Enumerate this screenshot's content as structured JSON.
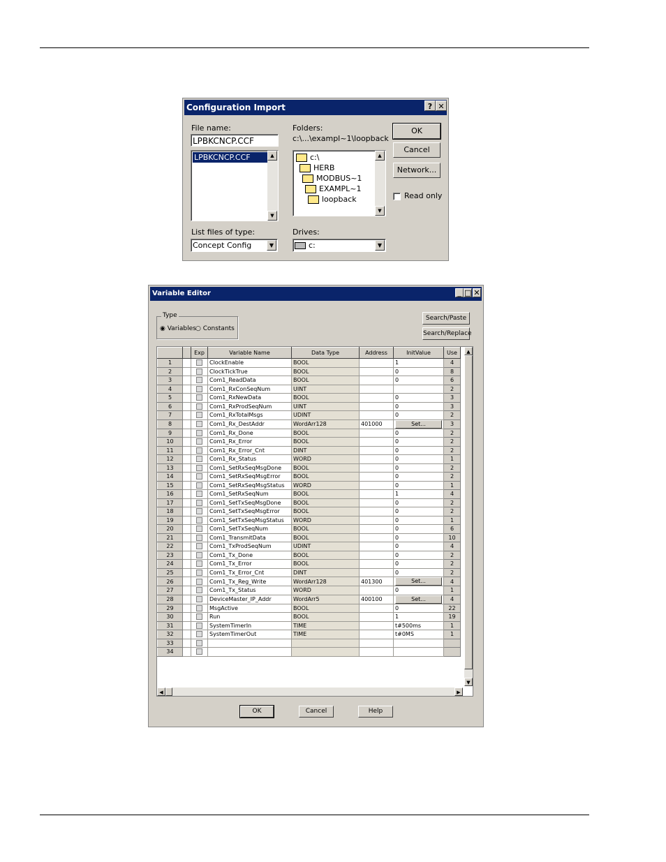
{
  "config_import": {
    "title": "Configuration Import",
    "help_btn": "?",
    "close_btn": "✕",
    "file_name_label": "File name:",
    "file_name_value": "LPBKCNCP.CCF",
    "file_list": [
      "LPBKCNCP.CCF"
    ],
    "folders_label": "Folders:",
    "folders_path": "c:\\...\\exampl~1\\loopback",
    "folders": [
      "c:\\",
      "HERB",
      "MODBUS~1",
      "EXAMPL~1",
      "loopback"
    ],
    "ok": "OK",
    "cancel": "Cancel",
    "network": "Network...",
    "read_only": "Read only",
    "list_type_label": "List files of type:",
    "list_type_value": "Concept Config (*.ccf)",
    "drives_label": "Drives:",
    "drives_value": "c:"
  },
  "variable_editor": {
    "title": "Variable Editor",
    "type_group": "Type",
    "radio_variables": "Variables",
    "radio_constants": "Constants",
    "search_paste": "Search/Paste",
    "search_replace": "Search/Replace",
    "columns": [
      "",
      "",
      "Exp",
      "Variable Name",
      "Data Type",
      "Address",
      "InitValue",
      "Use"
    ],
    "rows": [
      {
        "n": "1",
        "name": "ClockEnable",
        "type": "BOOL",
        "addr": "",
        "init": "1",
        "use": "4"
      },
      {
        "n": "2",
        "name": "ClockTickTrue",
        "type": "BOOL",
        "addr": "",
        "init": "0",
        "use": "8"
      },
      {
        "n": "3",
        "name": "Com1_ReadData",
        "type": "BOOL",
        "addr": "",
        "init": "0",
        "use": "6"
      },
      {
        "n": "4",
        "name": "Com1_RxConSeqNum",
        "type": "UINT",
        "addr": "",
        "init": "",
        "use": "2"
      },
      {
        "n": "5",
        "name": "Com1_RxNewData",
        "type": "BOOL",
        "addr": "",
        "init": "0",
        "use": "3"
      },
      {
        "n": "6",
        "name": "Com1_RxProdSeqNum",
        "type": "UINT",
        "addr": "",
        "init": "0",
        "use": "3"
      },
      {
        "n": "7",
        "name": "Com1_RxTotalMsgs",
        "type": "UDINT",
        "addr": "",
        "init": "0",
        "use": "2"
      },
      {
        "n": "8",
        "name": "Com1_Rx_DestAddr",
        "type": "WordArr128",
        "addr": "401000",
        "init": "Set...",
        "use": "3"
      },
      {
        "n": "9",
        "name": "Com1_Rx_Done",
        "type": "BOOL",
        "addr": "",
        "init": "0",
        "use": "2"
      },
      {
        "n": "10",
        "name": "Com1_Rx_Error",
        "type": "BOOL",
        "addr": "",
        "init": "0",
        "use": "2"
      },
      {
        "n": "11",
        "name": "Com1_Rx_Error_Cnt",
        "type": "DINT",
        "addr": "",
        "init": "0",
        "use": "2"
      },
      {
        "n": "12",
        "name": "Com1_Rx_Status",
        "type": "WORD",
        "addr": "",
        "init": "0",
        "use": "1"
      },
      {
        "n": "13",
        "name": "Com1_SetRxSeqMsgDone",
        "type": "BOOL",
        "addr": "",
        "init": "0",
        "use": "2"
      },
      {
        "n": "14",
        "name": "Com1_SetRxSeqMsgError",
        "type": "BOOL",
        "addr": "",
        "init": "0",
        "use": "2"
      },
      {
        "n": "15",
        "name": "Com1_SetRxSeqMsgStatus",
        "type": "WORD",
        "addr": "",
        "init": "0",
        "use": "1"
      },
      {
        "n": "16",
        "name": "Com1_SetRxSeqNum",
        "type": "BOOL",
        "addr": "",
        "init": "1",
        "use": "4"
      },
      {
        "n": "17",
        "name": "Com1_SetTxSeqMsgDone",
        "type": "BOOL",
        "addr": "",
        "init": "0",
        "use": "2"
      },
      {
        "n": "18",
        "name": "Com1_SetTxSeqMsgError",
        "type": "BOOL",
        "addr": "",
        "init": "0",
        "use": "2"
      },
      {
        "n": "19",
        "name": "Com1_SetTxSeqMsgStatus",
        "type": "WORD",
        "addr": "",
        "init": "0",
        "use": "1"
      },
      {
        "n": "20",
        "name": "Com1_SetTxSeqNum",
        "type": "BOOL",
        "addr": "",
        "init": "0",
        "use": "6"
      },
      {
        "n": "21",
        "name": "Com1_TransmitData",
        "type": "BOOL",
        "addr": "",
        "init": "0",
        "use": "10"
      },
      {
        "n": "22",
        "name": "Com1_TxProdSeqNum",
        "type": "UDINT",
        "addr": "",
        "init": "0",
        "use": "4"
      },
      {
        "n": "23",
        "name": "Com1_Tx_Done",
        "type": "BOOL",
        "addr": "",
        "init": "0",
        "use": "2"
      },
      {
        "n": "24",
        "name": "Com1_Tx_Error",
        "type": "BOOL",
        "addr": "",
        "init": "0",
        "use": "2"
      },
      {
        "n": "25",
        "name": "Com1_Tx_Error_Cnt",
        "type": "DINT",
        "addr": "",
        "init": "0",
        "use": "2"
      },
      {
        "n": "26",
        "name": "Com1_Tx_Reg_Write",
        "type": "WordArr128",
        "addr": "401300",
        "init": "Set...",
        "use": "4"
      },
      {
        "n": "27",
        "name": "Com1_Tx_Status",
        "type": "WORD",
        "addr": "",
        "init": "0",
        "use": "1"
      },
      {
        "n": "28",
        "name": "DeviceMaster_IP_Addr",
        "type": "WordArr5",
        "addr": "400100",
        "init": "Set...",
        "use": "4"
      },
      {
        "n": "29",
        "name": "MsgActive",
        "type": "BOOL",
        "addr": "",
        "init": "0",
        "use": "22"
      },
      {
        "n": "30",
        "name": "Run",
        "type": "BOOL",
        "addr": "",
        "init": "1",
        "use": "19"
      },
      {
        "n": "31",
        "name": "SystemTimerIn",
        "type": "TIME",
        "addr": "",
        "init": "t#500ms",
        "use": "1"
      },
      {
        "n": "32",
        "name": "SystemTimerOut",
        "type": "TIME",
        "addr": "",
        "init": "t#0MS",
        "use": "1"
      },
      {
        "n": "33",
        "name": "",
        "type": "",
        "addr": "",
        "init": "",
        "use": ""
      },
      {
        "n": "34",
        "name": "",
        "type": "",
        "addr": "",
        "init": "",
        "use": ""
      }
    ],
    "ok": "OK",
    "cancel": "Cancel",
    "help": "Help"
  }
}
